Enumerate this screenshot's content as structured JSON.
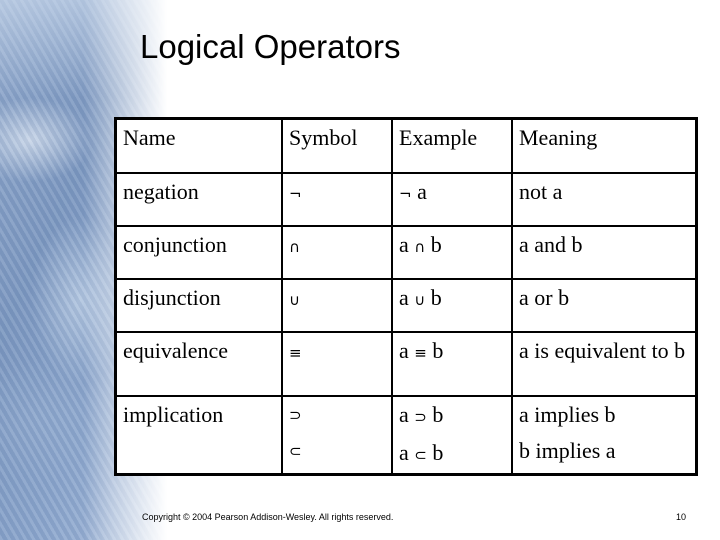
{
  "slide": {
    "title": "Logical Operators",
    "background_image": "mountain-photo"
  },
  "table": {
    "headers": [
      "Name",
      "Symbol",
      "Example",
      "Meaning"
    ],
    "rows": [
      {
        "name": "negation",
        "symbols": [
          "¬"
        ],
        "examples": [
          {
            "left": "",
            "op": "¬",
            "right": "a"
          }
        ],
        "meanings": [
          "not a"
        ]
      },
      {
        "name": "conjunction",
        "symbols": [
          "∩"
        ],
        "examples": [
          {
            "left": "a",
            "op": "∩",
            "right": "b"
          }
        ],
        "meanings": [
          "a and b"
        ]
      },
      {
        "name": "disjunction",
        "symbols": [
          "∪"
        ],
        "examples": [
          {
            "left": "a",
            "op": "∪",
            "right": "b"
          }
        ],
        "meanings": [
          "a or b"
        ]
      },
      {
        "name": "equivalence",
        "symbols": [
          "≡"
        ],
        "examples": [
          {
            "left": "a",
            "op": "≡",
            "right": "b"
          }
        ],
        "meanings": [
          "a is equivalent to b"
        ]
      },
      {
        "name": "implication",
        "symbols": [
          "⊃",
          "⊂"
        ],
        "examples": [
          {
            "left": "a",
            "op": "⊃",
            "right": "b"
          },
          {
            "left": "a",
            "op": "⊂",
            "right": "b"
          }
        ],
        "meanings": [
          "a implies b",
          "b implies a"
        ]
      }
    ]
  },
  "footer": {
    "copyright": "Copyright © 2004 Pearson Addison-Wesley. All rights reserved.",
    "page_number": "10"
  }
}
